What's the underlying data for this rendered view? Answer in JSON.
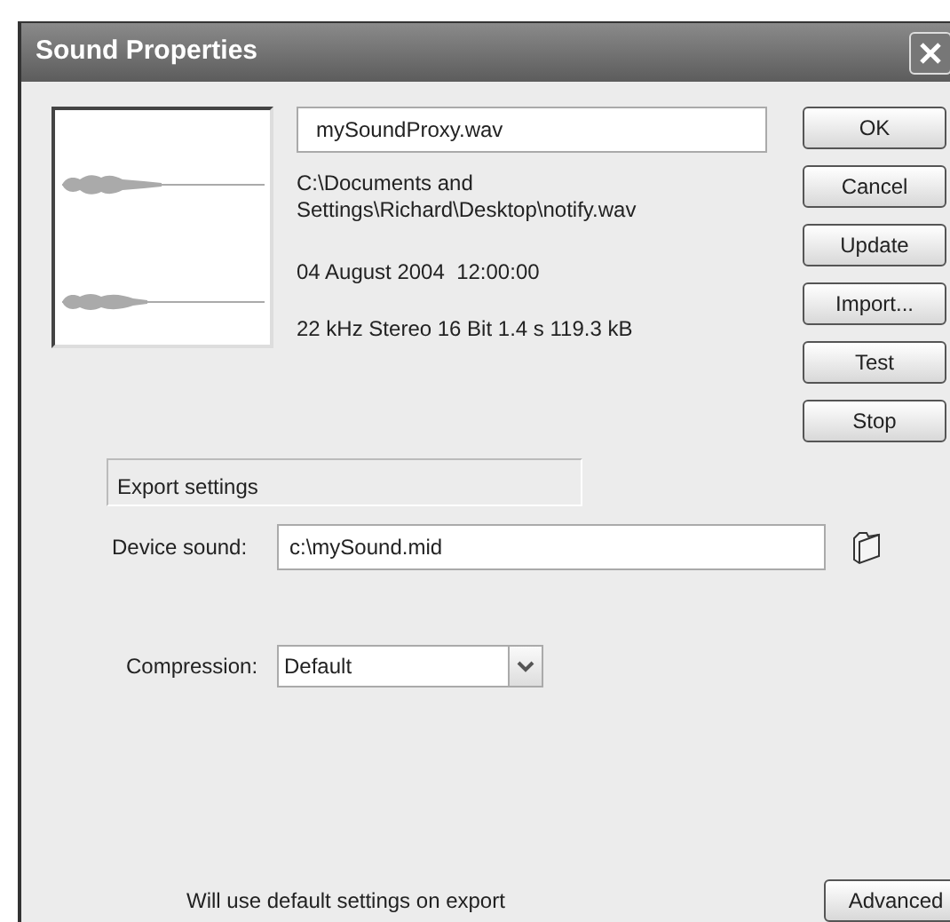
{
  "window": {
    "title": "Sound Properties"
  },
  "sound": {
    "name": "mySoundProxy.wav",
    "path": "C:\\Documents and Settings\\Richard\\Desktop\\notify.wav",
    "date": "04 August 2004  12:00:00",
    "format": "22 kHz Stereo 16 Bit 1.4 s 119.3 kB"
  },
  "buttons": [
    "OK",
    "Cancel",
    "Update",
    "Import...",
    "Test",
    "Stop"
  ],
  "export_settings": {
    "heading": "Export settings",
    "device_sound": {
      "label": "Device sound:",
      "value": "c:\\mySound.mid"
    },
    "compression": {
      "label": "Compression:",
      "value": "Default"
    }
  },
  "status": "Will use default settings on export",
  "advanced_button": "Advanced"
}
